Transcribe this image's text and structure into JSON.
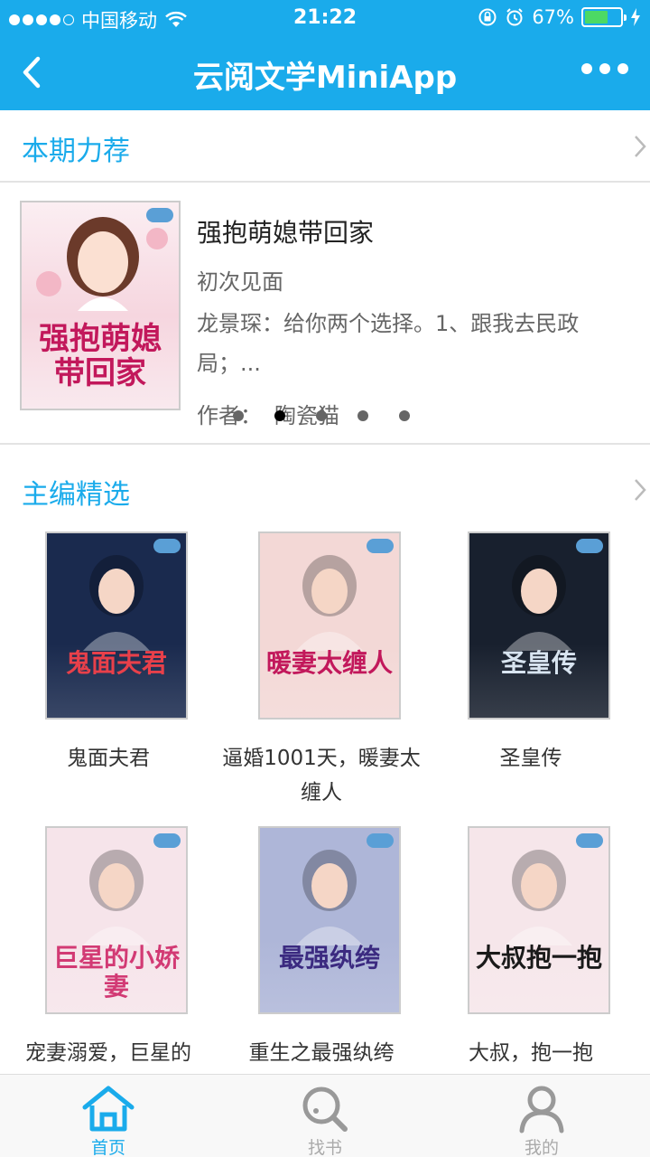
{
  "status_bar": {
    "carrier": "中国移动",
    "time": "21:22",
    "battery": "67%",
    "battery_level": 0.67
  },
  "nav": {
    "title": "云阅文学MiniApp"
  },
  "featured": {
    "section_title": "本期力荐",
    "book": {
      "title": "强抱萌媳带回家",
      "chapter": "初次见面",
      "description": "龙景琛：给你两个选择。1、跟我去民政局；...",
      "author_label": "作者：",
      "author": "陶瓷猫",
      "cover_text": "强抱萌媳带回家"
    },
    "carousel_count": 5,
    "carousel_active": 1
  },
  "editors_pick": {
    "section_title": "主编精选",
    "books": [
      {
        "title": "鬼面夫君",
        "cover_text": "鬼面夫君",
        "bg": "#1a2a4e",
        "fg": "#e8404a"
      },
      {
        "title": "逼婚1001天，暖妻太缠人",
        "cover_text": "暖妻太缠人",
        "bg": "#f3d8d6",
        "fg": "#c2185b"
      },
      {
        "title": "圣皇传",
        "cover_text": "圣皇传",
        "bg": "#18202e",
        "fg": "#d8e4f0"
      },
      {
        "title": "宠妻溺爱，巨星的",
        "cover_text": "巨星的小娇妻",
        "bg": "#f6e4ea",
        "fg": "#d23a74"
      },
      {
        "title": "重生之最强纨绔",
        "cover_text": "最强纨绔",
        "bg": "#aeb6d8",
        "fg": "#3b2a80"
      },
      {
        "title": "大叔，抱一抱",
        "cover_text": "大叔抱一抱",
        "bg": "#f6e6ea",
        "fg": "#1a1a1a"
      }
    ]
  },
  "tabs": [
    {
      "label": "首页",
      "icon": "home-icon",
      "active": true
    },
    {
      "label": "找书",
      "icon": "search-icon",
      "active": false
    },
    {
      "label": "我的",
      "icon": "user-icon",
      "active": false
    }
  ]
}
